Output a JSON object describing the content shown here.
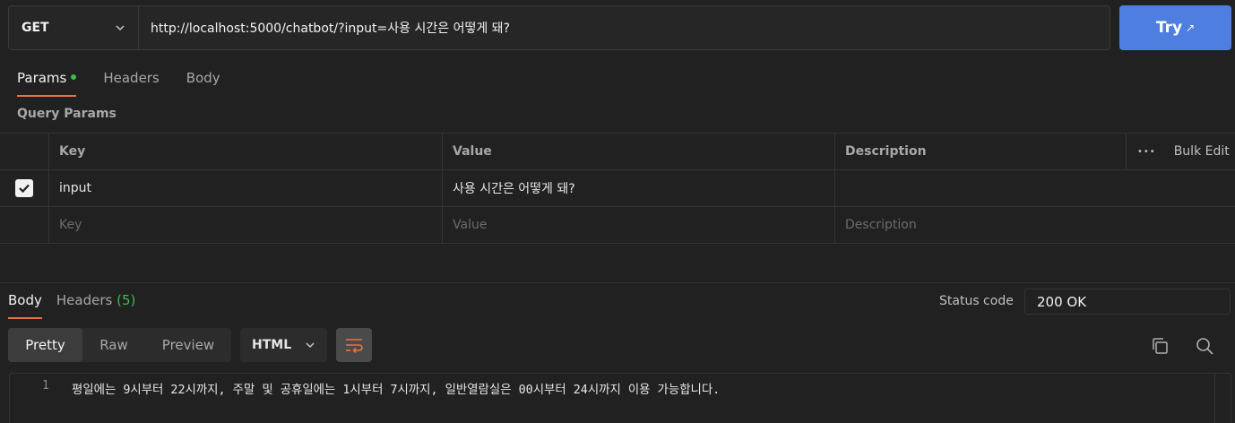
{
  "request": {
    "method": "GET",
    "url": "http://localhost:5000/chatbot/?input=사용 시간은 어떻게 돼?",
    "try_label": "Try",
    "try_arrow": "↗"
  },
  "tabs": [
    {
      "label": "Params",
      "active": true,
      "has_dot": true
    },
    {
      "label": "Headers",
      "active": false
    },
    {
      "label": "Body",
      "active": false
    }
  ],
  "query_params": {
    "title": "Query Params",
    "headers": {
      "key": "Key",
      "value": "Value",
      "description": "Description",
      "bulk_edit": "Bulk Edit",
      "more": "•••"
    },
    "rows": [
      {
        "checked": true,
        "key": "input",
        "value": "사용 시간은 어떻게 돼?",
        "description": ""
      }
    ],
    "placeholders": {
      "key": "Key",
      "value": "Value",
      "description": "Description"
    }
  },
  "response": {
    "tabs": [
      {
        "label": "Body",
        "active": true
      },
      {
        "label": "Headers",
        "count": "(5)",
        "active": false
      }
    ],
    "status_label": "Status code",
    "status_value": "200 OK",
    "view_modes": [
      "Pretty",
      "Raw",
      "Preview"
    ],
    "active_view": "Pretty",
    "format": "HTML",
    "line_number": "1",
    "body_line": "평일에는 9시부터 22시까지, 주말 및 공휴일에는 1시부터 7시까지, 일반열람실은 00시부터 24시까지 이용 가능합니다."
  },
  "colors": {
    "accent": "#e8734a",
    "try_button": "#4e7fe0",
    "success": "#3fb950",
    "background": "#212121"
  }
}
